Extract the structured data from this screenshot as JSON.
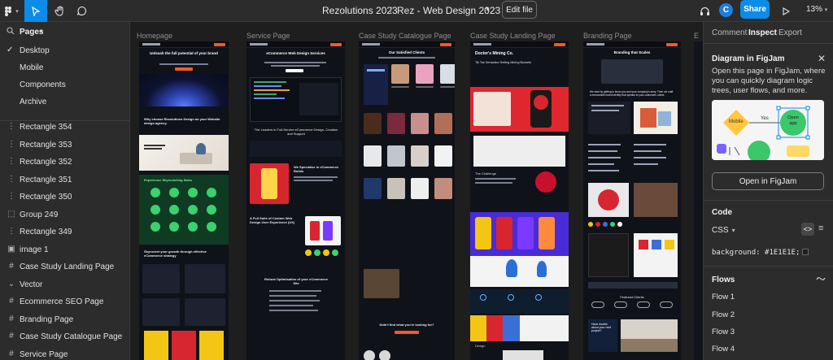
{
  "toolbar": {
    "project": "Rezolutions 2023",
    "separator": "/",
    "file": "Rez - Web Design 2023",
    "edit_label": "Edit file",
    "avatar_initial": "C",
    "share_label": "Share",
    "zoom": "13%"
  },
  "left": {
    "pages_label": "Pages",
    "pages": [
      {
        "label": "Desktop",
        "selected": true
      },
      {
        "label": "Mobile"
      },
      {
        "label": "Components"
      },
      {
        "label": "Archive"
      }
    ],
    "layers": [
      {
        "icon": "rect-icon",
        "label": "Rectangle 354"
      },
      {
        "icon": "rect-icon",
        "label": "Rectangle 353"
      },
      {
        "icon": "rect-icon",
        "label": "Rectangle 352"
      },
      {
        "icon": "rect-icon",
        "label": "Rectangle 351"
      },
      {
        "icon": "rect-icon",
        "label": "Rectangle 350"
      },
      {
        "icon": "group-icon",
        "label": "Group 249"
      },
      {
        "icon": "rect-icon",
        "label": "Rectangle 349"
      },
      {
        "icon": "image-icon",
        "label": "image 1"
      },
      {
        "icon": "frame-icon",
        "label": "Case Study Landing Page"
      },
      {
        "icon": "vector-icon",
        "label": "Vector"
      },
      {
        "icon": "frame-icon",
        "label": "Ecommerce SEO Page"
      },
      {
        "icon": "frame-icon",
        "label": "Branding Page"
      },
      {
        "icon": "frame-icon",
        "label": "Case Study Catalogue Page"
      },
      {
        "icon": "frame-icon",
        "label": "Service Page"
      }
    ]
  },
  "canvas": {
    "frames": [
      {
        "label": "Homepage",
        "hero_title": "Unleash the full potential of your brand",
        "section_title": "Why choose Rezolutions Design as your Website design agency",
        "features_title": "Experience Skyrocketing Sales",
        "growth_title": "Skyrocket your growth through effective eCommerce strategy"
      },
      {
        "label": "Service Page",
        "hero_title": "eCommerce Web Design Services",
        "leaders_title": "The Leaders in Full-Service eCommerce Design, Creation and Support",
        "special_title": "We Specialise in eCommerce Builds",
        "custom_title": "A Full Suite of Custom Web Design User Experience (UX)",
        "robust_title": "Robust Optimisation of your eCommerce Site"
      },
      {
        "label": "Case Study Catalogue Page",
        "hero_title": "Our Satisfied Clients",
        "cta_title": "Didn't find what you're looking for?"
      },
      {
        "label": "Case Study Landing Page",
        "hero_title": "Doctor's Mining Co.",
        "sub_title": "Tik Tok Sensation Selling Mining Buckets",
        "challenge_title": "The Challenge",
        "dark_title": "Design"
      },
      {
        "label": "Branding Page",
        "hero_title": "Branding that Scales",
        "intro": "We start by getting to know you and your company's story. Then we craft a memorable brand identity that speaks to your customers online.",
        "featured_title": "Featured Clients",
        "doubt_title": "Have doubts about your next project?"
      },
      {
        "label": "E"
      }
    ]
  },
  "right": {
    "tabs": [
      "Comment",
      "Inspect",
      "Export"
    ],
    "active_tab": "Inspect",
    "card": {
      "title": "Diagram in FigJam",
      "desc": "Open this page in FigJam, where you can quickly diagram logic trees, user flows, and more.",
      "button": "Open in FigJam",
      "preview_labels": {
        "mobile": "Mobile",
        "yes": "Yes",
        "open": "Open app"
      }
    },
    "code": {
      "title": "Code",
      "language": "CSS",
      "line": "background: #1E1E1E;",
      "swatch": "#1E1E1E"
    },
    "flows": {
      "title": "Flows",
      "items": [
        "Flow 1",
        "Flow 2",
        "Flow 3",
        "Flow 4"
      ]
    }
  },
  "colors": {
    "accent_blue": "#0C8CE9",
    "brand_orange": "#F05A28",
    "canvas_bg": "#1E1E1E",
    "panel_bg": "#2C2C2C"
  }
}
